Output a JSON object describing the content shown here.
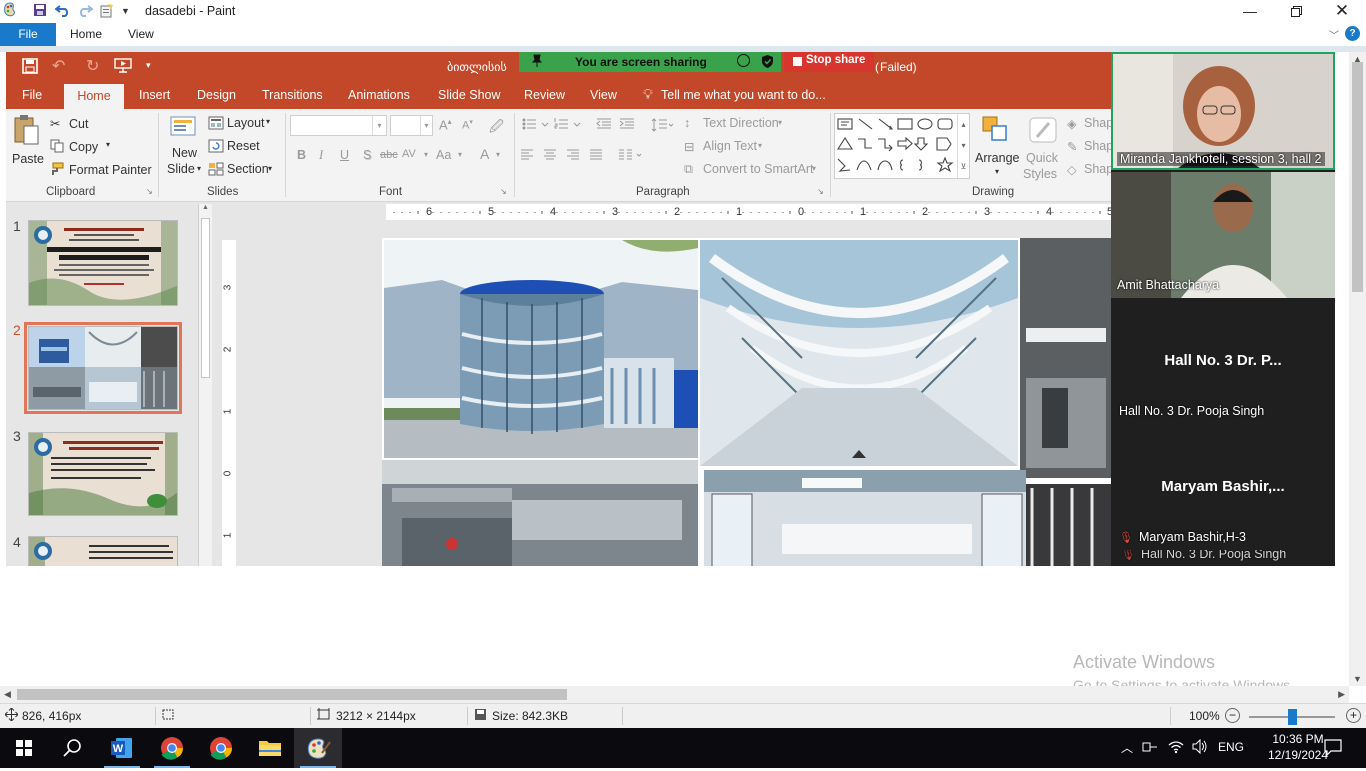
{
  "paint": {
    "window_title": "dasadebi - Paint",
    "menu": {
      "file": "File",
      "home": "Home",
      "view": "View"
    },
    "help": "?",
    "status": {
      "cursor_pos": "826, 416px",
      "image_dims": "3212 × 2144px",
      "file_size": "Size: 842.3KB",
      "zoom": "100%",
      "zoom_level": 1.0
    }
  },
  "ppt": {
    "title_fragment_left": "ბითლისის",
    "title_fragment_right": "Failed)",
    "tabs": [
      "File",
      "Home",
      "Insert",
      "Design",
      "Transitions",
      "Animations",
      "Slide Show",
      "Review",
      "View"
    ],
    "tell_me": "Tell me what you want to do...",
    "clipboard": {
      "paste": "Paste",
      "cut": "Cut",
      "copy": "Copy",
      "format_painter": "Format Painter",
      "label": "Clipboard"
    },
    "slides": {
      "new_slide_1": "New",
      "new_slide_2": "Slide",
      "layout": "Layout",
      "reset": "Reset",
      "section": "Section",
      "label": "Slides"
    },
    "font": {
      "label": "Font",
      "bold": "B",
      "italic": "I",
      "underline": "U",
      "shadow": "S",
      "strike": "abc",
      "spacing": "AV",
      "case": "Aa",
      "color": "A"
    },
    "paragraph": {
      "label": "Paragraph",
      "text_direction": "Text Direction",
      "align_text": "Align Text",
      "smartart": "Convert to SmartArt"
    },
    "drawing": {
      "label": "Drawing",
      "arrange": "Arrange",
      "quick_1": "Quick",
      "quick_2": "Styles",
      "shape_fill": "Shap",
      "shape_outline": "Shap",
      "shape_effects": "Shap"
    },
    "sharing": {
      "label": "You are screen sharing",
      "stop": "Stop share"
    },
    "slide_numbers": [
      "1",
      "2",
      "3",
      "4"
    ],
    "ruler_h": [
      "6",
      "5",
      "4",
      "3",
      "2",
      "1",
      "0",
      "1",
      "2",
      "3",
      "4",
      "5"
    ],
    "ruler_v": [
      "3",
      "2",
      "1",
      "0",
      "1"
    ]
  },
  "participants": [
    {
      "name": "Miranda Jankhoteli, session 3, hall 2"
    },
    {
      "name": "Amit Bhattacharya"
    },
    {
      "title": "Hall No. 3  Dr. P...",
      "name": "Hall No. 3 Dr. Pooja Singh"
    },
    {
      "title": "Maryam  Bashir,...",
      "name": "Maryam Bashir,H-3"
    },
    {
      "name": "Hall No. 3 Dr. Pooja Singh"
    }
  ],
  "activate_windows": {
    "title": "Activate Windows",
    "subtitle": "Go to Settings to activate Windows."
  },
  "taskbar": {
    "language": "ENG",
    "time": "10:36 PM",
    "date": "12/19/2024"
  }
}
